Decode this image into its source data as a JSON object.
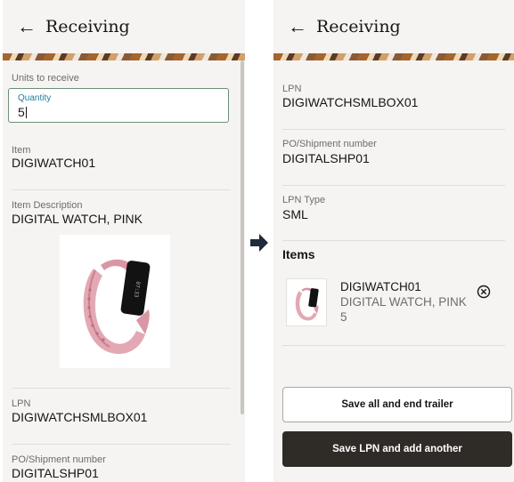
{
  "left_screen": {
    "title": "Receiving",
    "section_label": "Units to receive",
    "quantity": {
      "label": "Quantity",
      "value": "5"
    },
    "fields": [
      {
        "label": "Item",
        "value": "DIGIWATCH01"
      },
      {
        "label": "Item Description",
        "value": "DIGITAL WATCH, PINK"
      },
      {
        "label": "LPN",
        "value": "DIGIWATCHSMLBOX01"
      },
      {
        "label": "PO/Shipment number",
        "value": "DIGITALSHP01"
      }
    ]
  },
  "right_screen": {
    "title": "Receiving",
    "fields": [
      {
        "label": "LPN",
        "value": "DIGIWATCHSMLBOX01"
      },
      {
        "label": "PO/Shipment number",
        "value": "DIGITALSHP01"
      },
      {
        "label": "LPN Type",
        "value": "SML"
      }
    ],
    "items_heading": "Items",
    "items": [
      {
        "name": "DIGIWATCH01",
        "description": "DIGITAL WATCH, PINK",
        "quantity": "5"
      }
    ],
    "buttons": {
      "save_end_label": "Save all and end trailer",
      "save_add_label": "Save LPN and add another"
    }
  },
  "icons": {
    "back": "back-arrow-icon",
    "remove": "remove-circle-x-icon",
    "flow": "right-arrow-icon"
  },
  "colors": {
    "primary_button": "#2f2c28",
    "input_border": "#6b8f77",
    "floating_label": "#227e9e"
  }
}
